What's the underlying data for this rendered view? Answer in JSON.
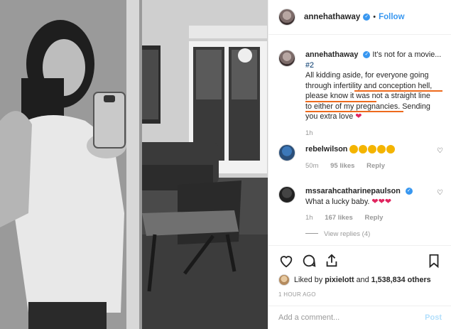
{
  "post": {
    "username": "annehathaway",
    "follow_label": "Follow",
    "separator": "•"
  },
  "caption": {
    "username": "annehathaway",
    "line1": "It's not for a movie...",
    "line2": "#2",
    "line3": "All kidding aside, for everyone going",
    "line4": "through infertility and conception hell,",
    "line5": "please know it was not a straight line",
    "line6": "to either of my pregnancies. Sending",
    "line7": "you extra love",
    "time": "1h"
  },
  "comments": [
    {
      "username": "rebelwilson",
      "time": "50m",
      "likes": "95 likes",
      "reply_label": "Reply"
    },
    {
      "username": "mssarahcatharinepaulson",
      "text": "What a lucky baby.",
      "time": "1h",
      "likes": "167 likes",
      "reply_label": "Reply",
      "view_replies": "View replies (4)"
    }
  ],
  "likes_line": {
    "prefix": "Liked by",
    "user": "pixielott",
    "and": "and",
    "count": "1,538,834 others"
  },
  "posted_ago": "1 HOUR AGO",
  "add_comment": {
    "placeholder": "Add a comment...",
    "post_label": "Post"
  },
  "colors": {
    "link": "#3897f0",
    "highlight": "#ed6a1d",
    "heart": "#e0245e"
  }
}
